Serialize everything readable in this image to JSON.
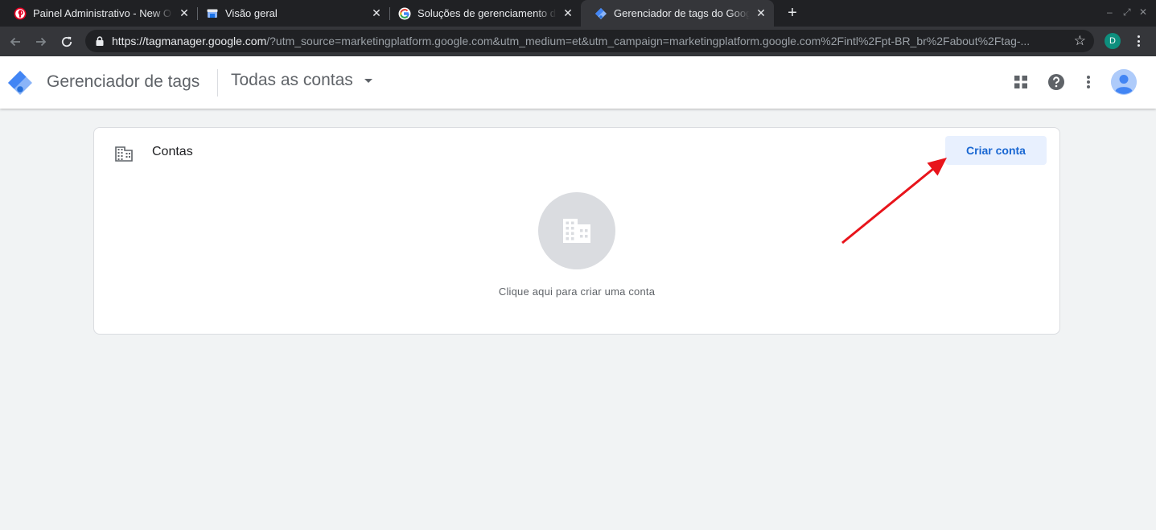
{
  "browser": {
    "tabs": [
      {
        "title": "Painel Administrativo - New O",
        "icon": "pinterest-icon"
      },
      {
        "title": "Visão geral",
        "icon": "store-icon"
      },
      {
        "title": "Soluções de gerenciamento d",
        "icon": "google-g-icon"
      },
      {
        "title": "Gerenciador de tags do Goog",
        "icon": "tag-manager-icon",
        "active": true
      }
    ],
    "url_host": "https://tagmanager.google.com",
    "url_rest": "/?utm_source=marketingplatform.google.com&utm_medium=et&utm_campaign=marketingplatform.google.com%2Fintl%2Fpt-BR_br%2Fabout%2Ftag-...",
    "profile_initial": "D"
  },
  "app": {
    "product_name": "Gerenciador de tags",
    "account_selector": "Todas as contas"
  },
  "card": {
    "title": "Contas",
    "create_button": "Criar conta",
    "empty_text": "Clique aqui para criar uma conta"
  },
  "colors": {
    "accent": "#1967d2",
    "button_bg": "#e8f0fe",
    "annotation_arrow": "#e8141b"
  }
}
